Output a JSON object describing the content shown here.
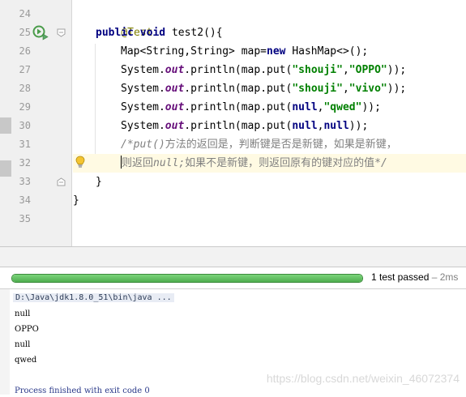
{
  "editor": {
    "line_numbers": [
      "24",
      "25",
      "26",
      "27",
      "28",
      "29",
      "30",
      "31",
      "32",
      "33",
      "34",
      "35"
    ],
    "line24": {
      "annotation": "@Test"
    },
    "line25": {
      "kw1": "public",
      "kw2": "void",
      "name": "test2(){"
    },
    "line26": {
      "t1": "Map<String,String> map=",
      "kw": "new",
      "t2": " HashMap<>();"
    },
    "line27": {
      "t1": "System.",
      "out": "out",
      "t2": ".println(map.put(",
      "s1": "\"shouji\"",
      "comma": ",",
      "s2": "\"OPPO\"",
      "t3": "));"
    },
    "line28": {
      "t1": "System.",
      "out": "out",
      "t2": ".println(map.put(",
      "s1": "\"shouji\"",
      "comma": ",",
      "s2": "\"vivo\"",
      "t3": "));"
    },
    "line29": {
      "t1": "System.",
      "out": "out",
      "t2": ".println(map.put(",
      "kw": "null",
      "comma": ",",
      "s2": "\"qwed\"",
      "t3": "));"
    },
    "line30": {
      "t1": "System.",
      "out": "out",
      "t2": ".println(map.put(",
      "kw1": "null",
      "comma": ",",
      "kw2": "null",
      "t3": "));"
    },
    "line31": {
      "c1": "/*",
      "c2": "put()",
      "c3": "方法的返回是，判断键是否是新键，如果是新键，"
    },
    "line32": {
      "c1": "则返回",
      "c2": "null",
      "c3": ";",
      "c4": "如果不是新键，则返回原有的键对应的值",
      "c5": "*/"
    },
    "line33": {
      "brace": "}"
    },
    "line34": {
      "brace": "}"
    }
  },
  "test_bar": {
    "progress": 1.0,
    "status": "1 test passed",
    "time": "– 2ms"
  },
  "console": {
    "command": "D:\\Java\\jdk1.8.0_51\\bin\\java ...",
    "lines": [
      "null",
      "OPPO",
      "null",
      "qwed"
    ],
    "exit": "Process finished with exit code 0",
    "watermark": "https://blog.csdn.net/weixin_46072374"
  },
  "colors": {
    "keyword": "#000080",
    "string": "#008000",
    "field": "#660e7a",
    "annotation": "#808000",
    "comment": "#808080",
    "progress": "#4fae4f"
  },
  "icons": [
    "run-test-icon",
    "fold-icon",
    "lightbulb-icon"
  ]
}
